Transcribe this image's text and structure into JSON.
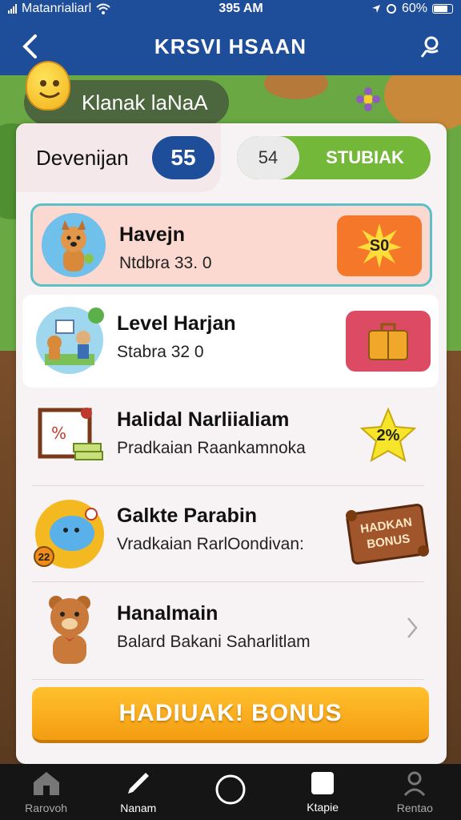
{
  "status": {
    "carrier": "Matanrialiarl",
    "time": "395 AM",
    "battery": "60%"
  },
  "nav": {
    "title": "KRSVI HSAAN"
  },
  "profile": {
    "name": "Klanak laNaA"
  },
  "summary": {
    "label": "Devenijan",
    "score": "55",
    "toggle_value": "54",
    "toggle_label": "STUBIAK"
  },
  "rows": [
    {
      "title": "Havejn",
      "subtitle": "Ntdbra 33. 0",
      "reward": "S0",
      "reward_icon": "sun-burst-icon"
    },
    {
      "title": "Level Harjan",
      "subtitle": "Stabra 32 0",
      "reward_icon": "briefcase-icon"
    },
    {
      "title": "Halidal Narliialiam",
      "subtitle": "Pradkaian Raankamnoka",
      "reward": "2%",
      "reward_icon": "star-badge-icon"
    },
    {
      "title": "Galkte Parabin",
      "subtitle": "Vradkaian RarlOondivan:",
      "reward": "HADKAN BONUS",
      "reward_icon": "scroll-banner-icon"
    },
    {
      "title": "Hanalmain",
      "subtitle": "Balard Bakani Saharlitlam"
    }
  ],
  "avatar_badge": "22",
  "cta": {
    "label": "HADIUAK! BONUS"
  },
  "tabs": [
    {
      "label": "Rarovoh",
      "icon": "home-icon"
    },
    {
      "label": "Nanam",
      "icon": "edit-icon"
    },
    {
      "label": "",
      "icon": "circle-icon"
    },
    {
      "label": "Ktapie",
      "icon": "square-icon"
    },
    {
      "label": "Rentao",
      "icon": "profile-icon"
    }
  ],
  "colors": {
    "primary": "#1e4d9a",
    "accent": "#f49d12",
    "green": "#74b83a"
  }
}
